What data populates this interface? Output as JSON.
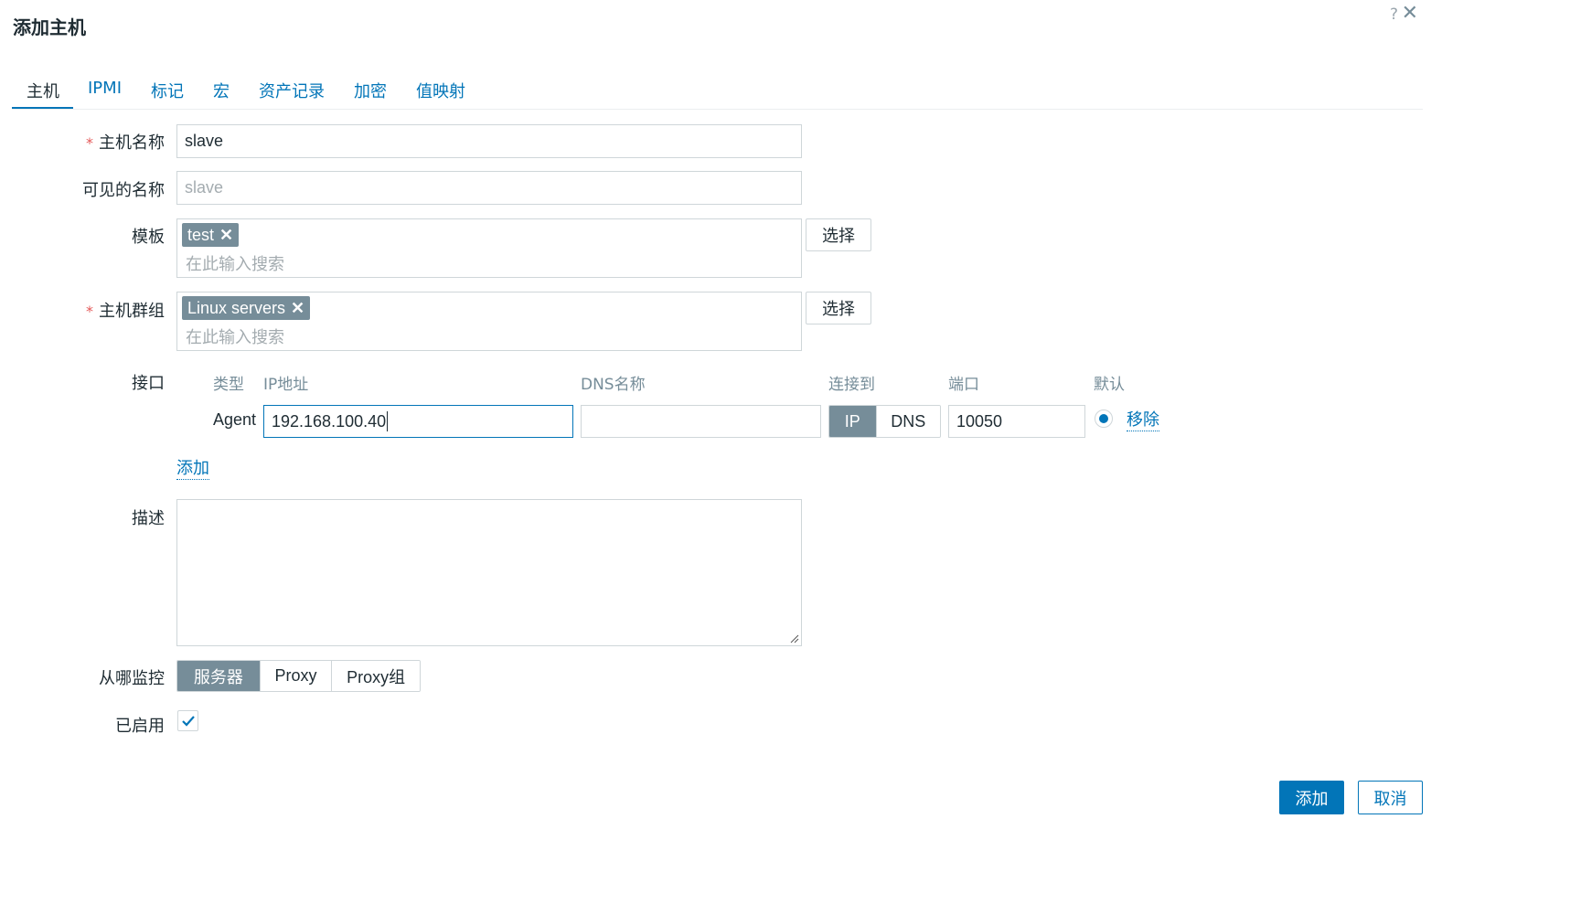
{
  "dialog": {
    "title": "添加主机",
    "help_glyph": "?",
    "close_glyph": "✕"
  },
  "tabs": [
    {
      "label": "主机",
      "active": true
    },
    {
      "label": "IPMI"
    },
    {
      "label": "标记"
    },
    {
      "label": "宏"
    },
    {
      "label": "资产记录"
    },
    {
      "label": "加密"
    },
    {
      "label": "值映射"
    }
  ],
  "form": {
    "required_mark": "*",
    "host_name": {
      "label": "主机名称",
      "value": "slave"
    },
    "visible_name": {
      "label": "可见的名称",
      "placeholder": "slave"
    },
    "templates": {
      "label": "模板",
      "chips": [
        "test"
      ],
      "search_placeholder": "在此输入搜索",
      "select_label": "选择"
    },
    "host_groups": {
      "label": "主机群组",
      "chips": [
        "Linux servers"
      ],
      "search_placeholder": "在此输入搜索",
      "select_label": "选择"
    },
    "interfaces": {
      "label": "接口",
      "headers": {
        "type": "类型",
        "ip": "IP地址",
        "dns": "DNS名称",
        "connect_to": "连接到",
        "port": "端口",
        "default": "默认"
      },
      "rows": [
        {
          "type": "Agent",
          "ip": "192.168.100.40",
          "dns": "",
          "connect_options": [
            "IP",
            "DNS"
          ],
          "connect_selected": "IP",
          "port": "10050",
          "default": true,
          "remove_label": "移除"
        }
      ],
      "add_label": "添加"
    },
    "description": {
      "label": "描述",
      "value": ""
    },
    "monitored_by": {
      "label": "从哪监控",
      "options": [
        "服务器",
        "Proxy",
        "Proxy组"
      ],
      "selected": "服务器"
    },
    "enabled": {
      "label": "已启用",
      "checked": true
    }
  },
  "footer": {
    "add_label": "添加",
    "cancel_label": "取消"
  },
  "colors": {
    "accent": "#0275b8",
    "active_segment": "#768d99",
    "required": "#e45959"
  }
}
